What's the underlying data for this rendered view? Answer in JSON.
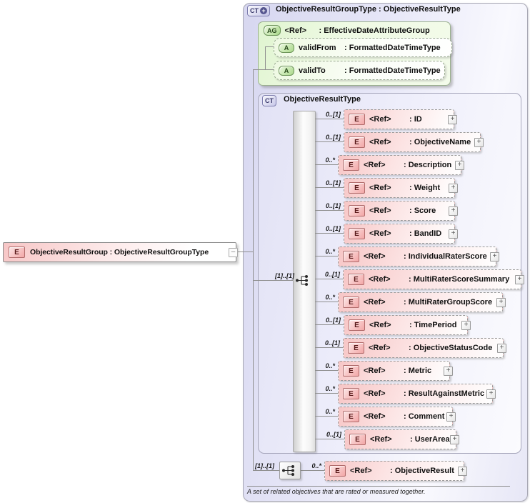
{
  "glyphs": {
    "plus": "+",
    "minus": "–"
  },
  "colors": {
    "element_pink": "#f7c6c6",
    "attribute_green": "#a9d889",
    "type_lavender": "#dcdcf2",
    "border_gray": "#9a9a9a",
    "line_gray": "#8f8f8f"
  },
  "diagram": {
    "root_element": {
      "badge": "E",
      "label": "ObjectiveResultGroup : ObjectiveResultGroupType"
    },
    "outer_type": {
      "badge": "CT",
      "title": "ObjectiveResultGroupType : ObjectiveResultType"
    },
    "attribute_group": {
      "badge": "AG",
      "ref": "<Ref>",
      "type_label": ": EffectiveDateAttributeGroup",
      "attributes": [
        {
          "badge": "A",
          "name": "validFrom",
          "type_label": ": FormattedDateTimeType"
        },
        {
          "badge": "A",
          "name": "validTo",
          "type_label": ": FormattedDateTimeType"
        }
      ]
    },
    "inner_type": {
      "badge": "CT",
      "title": "ObjectiveResultType",
      "sequence_cardinality": "[1]..[1]",
      "elements": [
        {
          "badge": "E",
          "cardinality": "0..[1]",
          "ref": "<Ref>",
          "type_label": ": ID"
        },
        {
          "badge": "E",
          "cardinality": "0..[1]",
          "ref": "<Ref>",
          "type_label": ": ObjectiveName"
        },
        {
          "badge": "E",
          "cardinality": "0..*",
          "ref": "<Ref>",
          "type_label": ": Description"
        },
        {
          "badge": "E",
          "cardinality": "0..[1]",
          "ref": "<Ref>",
          "type_label": ": Weight"
        },
        {
          "badge": "E",
          "cardinality": "0..[1]",
          "ref": "<Ref>",
          "type_label": ": Score"
        },
        {
          "badge": "E",
          "cardinality": "0..[1]",
          "ref": "<Ref>",
          "type_label": ": BandID"
        },
        {
          "badge": "E",
          "cardinality": "0..*",
          "ref": "<Ref>",
          "type_label": ": IndividualRaterScore"
        },
        {
          "badge": "E",
          "cardinality": "0..[1]",
          "ref": "<Ref>",
          "type_label": ": MultiRaterScoreSummary"
        },
        {
          "badge": "E",
          "cardinality": "0..*",
          "ref": "<Ref>",
          "type_label": ": MultiRaterGroupScore"
        },
        {
          "badge": "E",
          "cardinality": "0..[1]",
          "ref": "<Ref>",
          "type_label": ": TimePeriod"
        },
        {
          "badge": "E",
          "cardinality": "0..[1]",
          "ref": "<Ref>",
          "type_label": ": ObjectiveStatusCode"
        },
        {
          "badge": "E",
          "cardinality": "0..*",
          "ref": "<Ref>",
          "type_label": ": Metric"
        },
        {
          "badge": "E",
          "cardinality": "0..*",
          "ref": "<Ref>",
          "type_label": ": ResultAgainstMetric"
        },
        {
          "badge": "E",
          "cardinality": "0..*",
          "ref": "<Ref>",
          "type_label": ": Comment"
        },
        {
          "badge": "E",
          "cardinality": "0..[1]",
          "ref": "<Ref>",
          "type_label": ": UserArea"
        }
      ]
    },
    "extension": {
      "sequence_cardinality": "[1]..[1]",
      "element": {
        "badge": "E",
        "cardinality": "0..*",
        "ref": "<Ref>",
        "type_label": ": ObjectiveResult"
      }
    },
    "footer_note": "A set of related objectives that are rated or measured together."
  }
}
